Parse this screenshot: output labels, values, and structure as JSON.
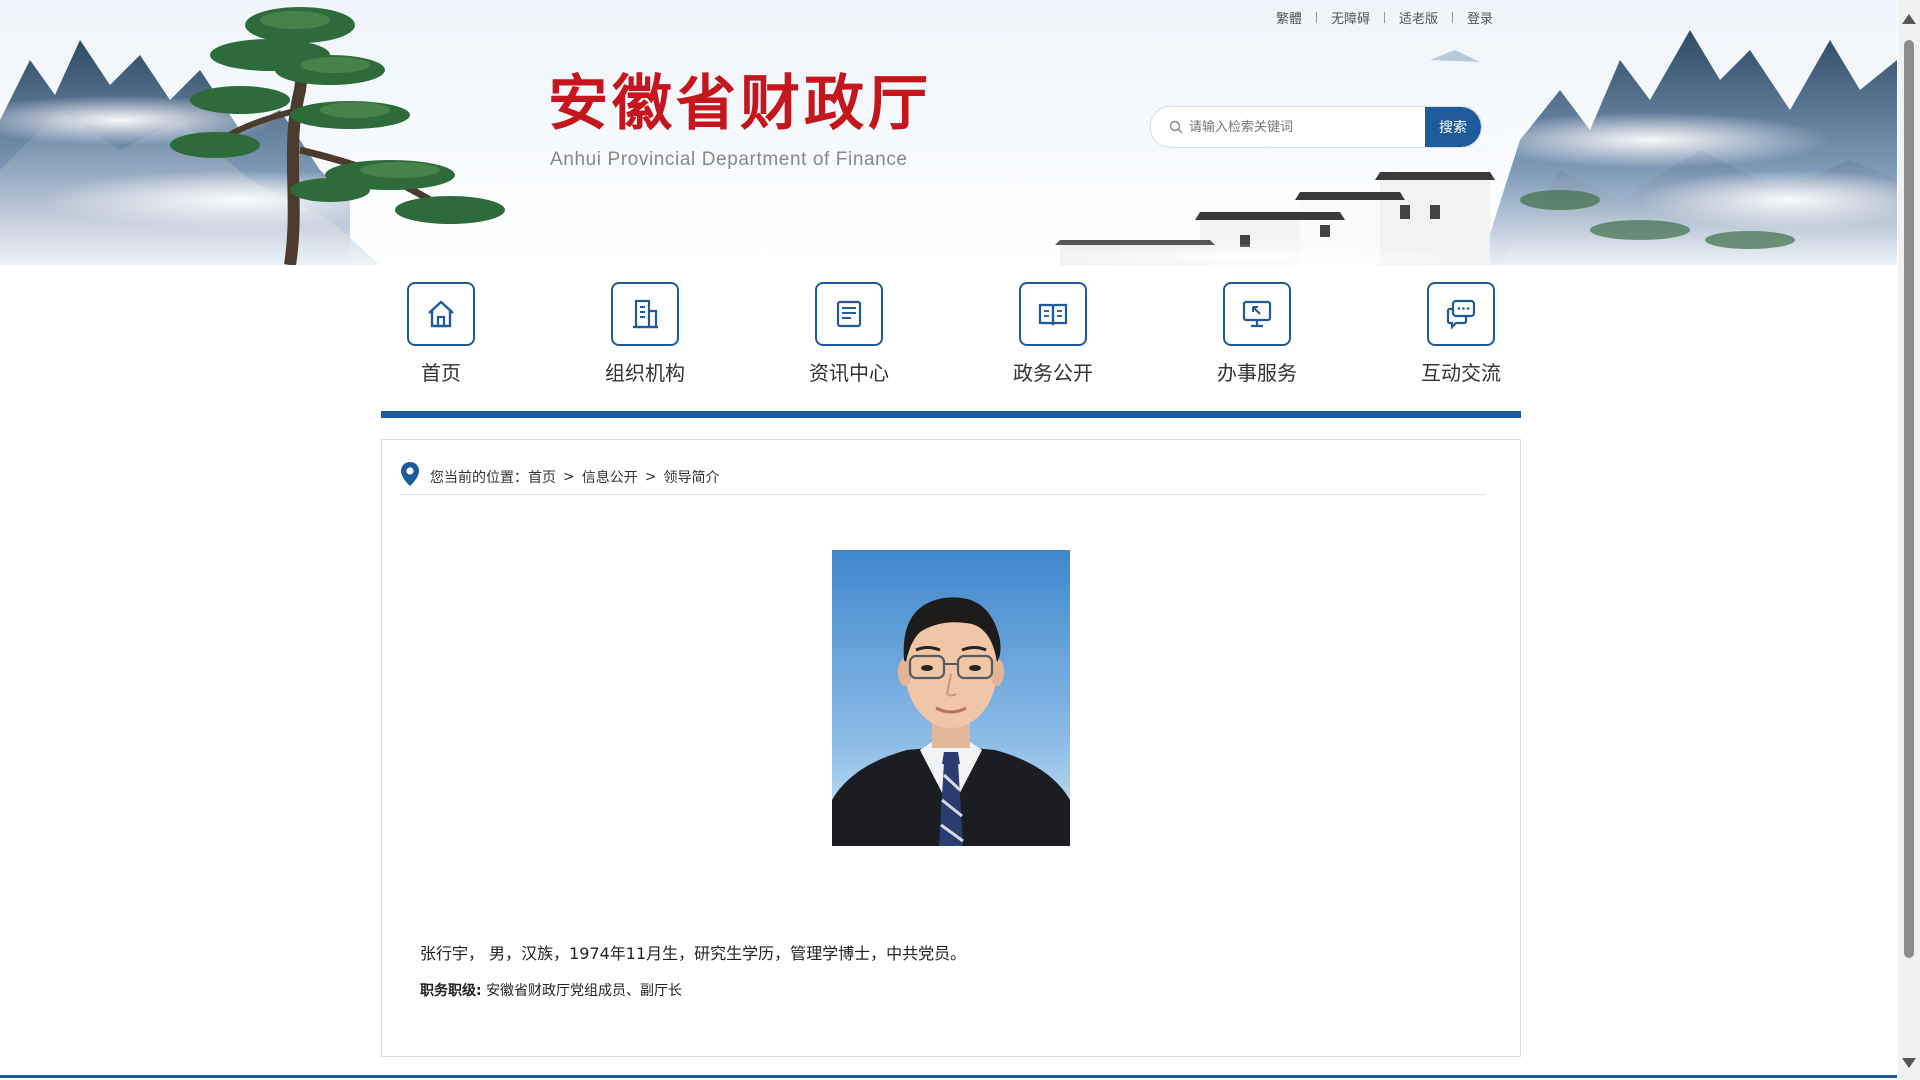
{
  "header": {
    "top_links": [
      "繁體",
      "无障碍",
      "适老版",
      "登录"
    ],
    "logo_cn": "安徽省财政厅",
    "logo_en": "Anhui Provincial Department of Finance",
    "search": {
      "placeholder": "请输入检索关键词",
      "button": "搜索"
    }
  },
  "nav": {
    "items": [
      {
        "label": "首页",
        "icon": "home-icon"
      },
      {
        "label": "组织机构",
        "icon": "building-icon"
      },
      {
        "label": "资讯中心",
        "icon": "document-icon"
      },
      {
        "label": "政务公开",
        "icon": "open-book-icon"
      },
      {
        "label": "办事服务",
        "icon": "monitor-icon"
      },
      {
        "label": "互动交流",
        "icon": "chat-icon"
      }
    ]
  },
  "breadcrumb": {
    "prefix": "您当前的位置：",
    "items": [
      "首页",
      "信息公开",
      "领导简介"
    ],
    "separator": ">"
  },
  "profile": {
    "bio": "张行宇， 男，汉族，1974年11月生，研究生学历，管理学博士，中共党员。",
    "duty_label": "职务职级:",
    "duty_value": "安徽省财政厅党组成员、副厅长"
  },
  "colors": {
    "brand_blue": "#1f5a9a",
    "logo_red": "#c4161c"
  }
}
